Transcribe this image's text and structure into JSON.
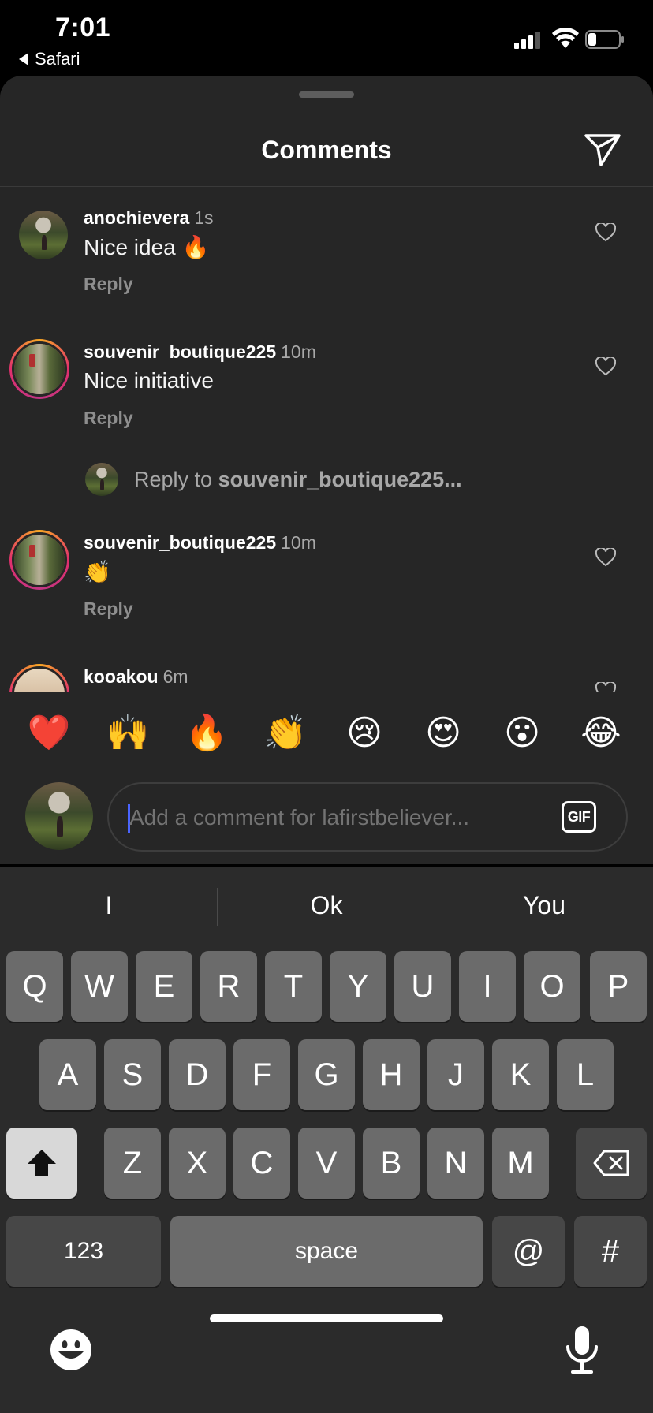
{
  "status_bar": {
    "time": "7:01",
    "back_app": "Safari"
  },
  "header": {
    "title": "Comments",
    "share_icon": "paper-plane-icon"
  },
  "comments": [
    {
      "username": "anochievera",
      "time": "1s",
      "text": "Nice idea 🔥",
      "reply": "Reply"
    },
    {
      "username": "souvenir_boutique225",
      "time": "10m",
      "text": "Nice initiative",
      "reply": "Reply"
    },
    {
      "username": "souvenir_boutique225",
      "time": "10m",
      "text": "👏",
      "reply": "Reply"
    },
    {
      "username": "kooakou",
      "time": "6m"
    }
  ],
  "reply_prompt": {
    "prefix": "Reply to",
    "username": "souvenir_boutique225..."
  },
  "quick_emojis": [
    "❤️",
    "🙌",
    "🔥",
    "👏",
    "😢",
    "😍",
    "😮",
    "😂"
  ],
  "composer": {
    "placeholder": "Add a comment for lafirstbeliever...",
    "gif_label": "GIF"
  },
  "keyboard": {
    "suggestions": [
      "I",
      "Ok",
      "You"
    ],
    "row1": [
      "Q",
      "W",
      "E",
      "R",
      "T",
      "Y",
      "U",
      "I",
      "O",
      "P"
    ],
    "row2": [
      "A",
      "S",
      "D",
      "F",
      "G",
      "H",
      "J",
      "K",
      "L"
    ],
    "row3": [
      "Z",
      "X",
      "C",
      "V",
      "B",
      "N",
      "M"
    ],
    "numbers_label": "123",
    "space_label": "space",
    "at_label": "@",
    "hash_label": "#"
  }
}
